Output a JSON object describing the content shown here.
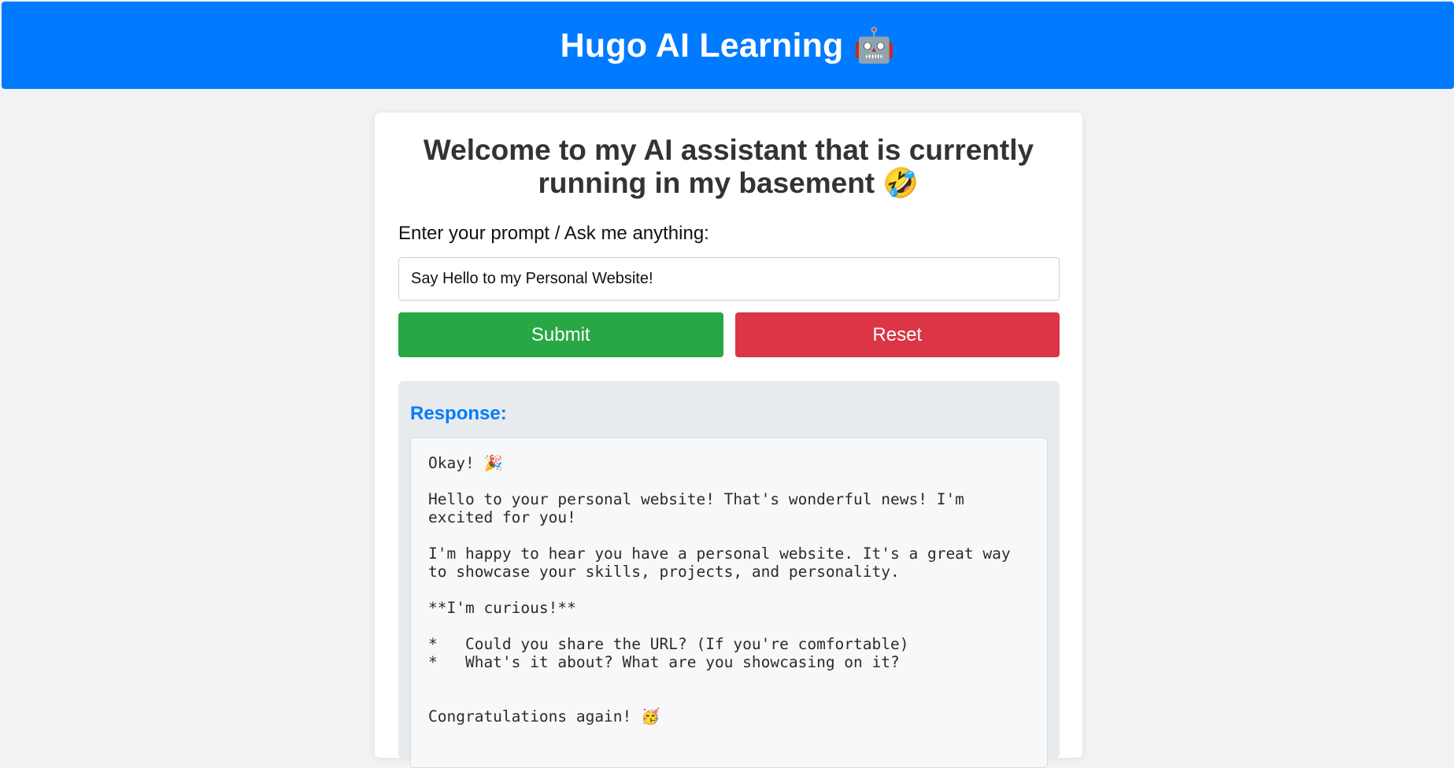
{
  "header": {
    "title": "Hugo AI Learning 🤖"
  },
  "card": {
    "heading": "Welcome to my AI assistant that is currently running in my basement 🤣",
    "prompt_label": "Enter your prompt / Ask me anything:",
    "prompt_value": "Say Hello to my Personal Website!",
    "submit_label": "Submit",
    "reset_label": "Reset",
    "response_title": "Response:",
    "response_text": "Okay! 🎉\n\nHello to your personal website! That's wonderful news! I'm\nexcited for you!\n\nI'm happy to hear you have a personal website. It's a great way\nto showcase your skills, projects, and personality.\n\n**I'm curious!**\n\n*   Could you share the URL? (If you're comfortable)\n*   What's it about? What are you showcasing on it?\n\n\nCongratulations again! 🥳"
  },
  "colors": {
    "header_bg": "#007bff",
    "submit_bg": "#28a745",
    "reset_bg": "#dc3545",
    "response_title": "#007bff"
  }
}
